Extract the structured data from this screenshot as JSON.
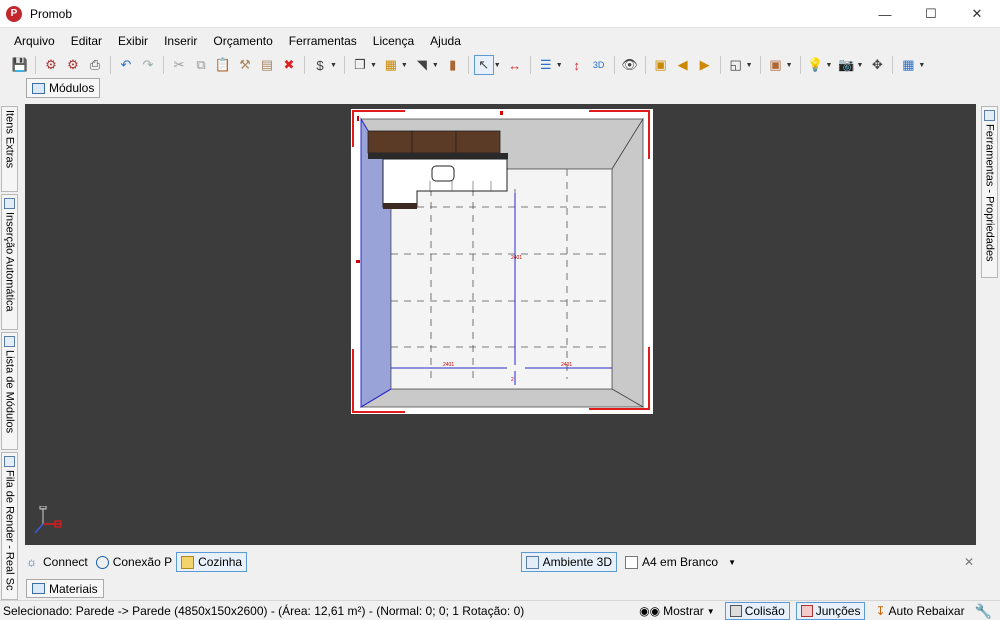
{
  "window": {
    "title": "Promob",
    "logo": "promob-logo-icon",
    "controls": [
      "minimize-icon",
      "maximize-icon",
      "close-icon"
    ]
  },
  "menu": [
    "Arquivo",
    "Editar",
    "Exibir",
    "Inserir",
    "Orçamento",
    "Ferramentas",
    "Licença",
    "Ajuda"
  ],
  "panels": {
    "modulos": "Módulos",
    "materiais": "Materiais"
  },
  "left_tabs": [
    "Itens Extras",
    "Inserção Automática",
    "Lista de Módulos",
    "Fila de Render - Real Sc"
  ],
  "right_tabs": [
    "Ferramentas - Propriedades"
  ],
  "bottom_tabs": {
    "connect": "Connect",
    "conexao": "Conexão P",
    "cozinha": "Cozinha",
    "ambiente": "Ambiente 3D",
    "a4": "A4 em Branco"
  },
  "status": {
    "text": "Selecionado: Parede -> Parede (4850x150x2600) - (Área: 12,61 m²) - (Normal: 0; 0; 1 Rotação: 0)",
    "mostrar": "Mostrar",
    "colisao": "Colisão",
    "juncoes": "Junções",
    "auto_rebaixar": "Auto Rebaixar"
  },
  "colors": {
    "viewport_bg": "#3c3c3c",
    "wall_red": "#e01b1b",
    "selection_blue": "#2a2ad0",
    "accent_blue": "#5a9bd5"
  }
}
